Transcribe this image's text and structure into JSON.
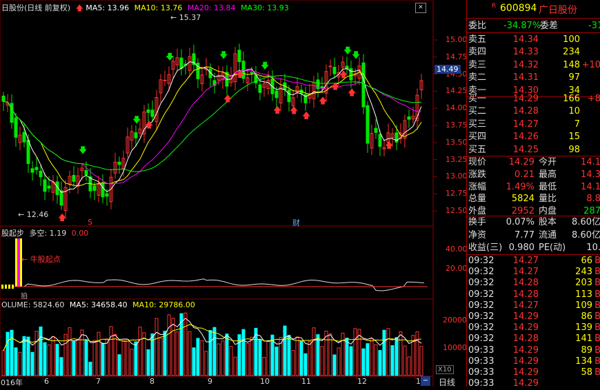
{
  "chart": {
    "title": "日股份(日线 前复权)",
    "ma5": "MA5: 13.96",
    "ma10": "MA10: 13.76",
    "ma20": "MA20: 13.84",
    "ma30": "MA30: 13.93",
    "high_label": "15.37",
    "low_label": "12.46",
    "current_price_tag": "14.49",
    "price_axis": [
      "15.00",
      "14.75",
      "14.50",
      "14.25",
      "14.00",
      "13.75",
      "13.50",
      "13.25",
      "13.00",
      "12.75",
      "12.50"
    ],
    "marker_s": "S",
    "marker_cai": "财",
    "indicator_title": "股起步",
    "indicator_duokong": "多空: 1.19",
    "indicator_value": "0.00",
    "indicator_axis": [
      "40.00",
      "20.00"
    ],
    "annotation": "牛股起点",
    "indicator_tag": "拍",
    "volume_title": "OLUME: 5824.60",
    "volume_ma5": "MA5: 34658.40",
    "volume_ma10": "MA10: 29786.00",
    "volume_axis": [
      "20000",
      "10000"
    ],
    "volume_unit": "X10",
    "date_labels": [
      "016年",
      "6",
      "7",
      "8",
      "9",
      "10",
      "11",
      "12",
      "1"
    ],
    "period_tab": "日线",
    "colors": {
      "up": "#ff3232",
      "down": "#00ffff",
      "ma5": "#ffffff",
      "ma10": "#ffff00",
      "ma20": "#ff00ff",
      "ma30": "#00ff00",
      "grid": "#8b0000"
    }
  },
  "quote": {
    "badge": "R",
    "code": "600894",
    "name": "广日股份",
    "weibi_label": "委比",
    "weibi_value": "-34.87%",
    "weicha_label": "委差",
    "weicha_value": "-31",
    "asks": [
      {
        "label": "卖五",
        "price": "14.34",
        "vol": "100",
        "extra": ""
      },
      {
        "label": "卖四",
        "price": "14.33",
        "vol": "234",
        "extra": ""
      },
      {
        "label": "卖三",
        "price": "14.32",
        "vol": "148",
        "extra": "+10"
      },
      {
        "label": "卖二",
        "price": "14.31",
        "vol": "97",
        "extra": ""
      },
      {
        "label": "卖一",
        "price": "14.30",
        "vol": "34",
        "extra": ""
      }
    ],
    "bids": [
      {
        "label": "买一",
        "price": "14.29",
        "vol": "166",
        "extra": "+8"
      },
      {
        "label": "买二",
        "price": "14.28",
        "vol": "10",
        "extra": ""
      },
      {
        "label": "买三",
        "price": "14.27",
        "vol": "7",
        "extra": ""
      },
      {
        "label": "买四",
        "price": "14.26",
        "vol": "15",
        "extra": ""
      },
      {
        "label": "买五",
        "price": "14.25",
        "vol": "98",
        "extra": ""
      }
    ],
    "stats": [
      {
        "l1": "现价",
        "v1": "14.29",
        "c1": "red",
        "l2": "今开",
        "v2": "14.1",
        "c2": "red"
      },
      {
        "l1": "涨跌",
        "v1": "0.21",
        "c1": "red",
        "l2": "最高",
        "v2": "14.3",
        "c2": "red"
      },
      {
        "l1": "涨幅",
        "v1": "1.49%",
        "c1": "red",
        "l2": "最低",
        "v2": "14.1",
        "c2": "red"
      },
      {
        "l1": "总量",
        "v1": "5824",
        "c1": "yel",
        "l2": "量比",
        "v2": "8.8",
        "c2": "red"
      },
      {
        "l1": "外盘",
        "v1": "2952",
        "c1": "red",
        "l2": "内盘",
        "v2": "287",
        "c2": "grn"
      }
    ],
    "fund": [
      {
        "l1": "换手",
        "v1": "0.07%",
        "l2": "股本",
        "v2": "8.60亿"
      },
      {
        "l1": "净资",
        "v1": "7.77",
        "l2": "流通",
        "v2": "8.60亿"
      },
      {
        "l1": "收益(三)",
        "v1": "0.980",
        "l2": "PE(动)",
        "v2": "10."
      }
    ],
    "ticks": [
      {
        "time": "09:32",
        "price": "14.27",
        "vol": "66",
        "dir": "B"
      },
      {
        "time": "09:32",
        "price": "14.27",
        "vol": "243",
        "dir": "B"
      },
      {
        "time": "09:32",
        "price": "14.28",
        "vol": "203",
        "dir": "B"
      },
      {
        "time": "09:32",
        "price": "14.28",
        "vol": "113",
        "dir": "B"
      },
      {
        "time": "09:32",
        "price": "14.27",
        "vol": "109",
        "dir": "B"
      },
      {
        "time": "09:32",
        "price": "14.29",
        "vol": "86",
        "dir": "B"
      },
      {
        "time": "09:32",
        "price": "14.29",
        "vol": "139",
        "dir": "B"
      },
      {
        "time": "09:32",
        "price": "14.28",
        "vol": "141",
        "dir": "B"
      },
      {
        "time": "09:33",
        "price": "14.29",
        "vol": "89",
        "dir": "B"
      },
      {
        "time": "09:33",
        "price": "14.29",
        "vol": "134",
        "dir": "B"
      },
      {
        "time": "09:33",
        "price": "14.29",
        "vol": "58",
        "dir": "B"
      },
      {
        "time": "09:33",
        "price": "14.29",
        "vol": "",
        "dir": ""
      }
    ]
  }
}
